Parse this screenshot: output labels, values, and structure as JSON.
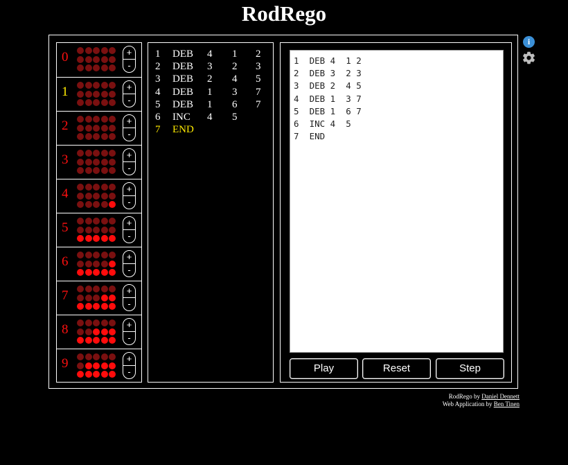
{
  "app": {
    "title": "RodRego"
  },
  "registers": [
    {
      "label": "0",
      "count": 0,
      "highlight": false
    },
    {
      "label": "1",
      "count": 0,
      "highlight": true
    },
    {
      "label": "2",
      "count": 0,
      "highlight": false
    },
    {
      "label": "3",
      "count": 0,
      "highlight": false
    },
    {
      "label": "4",
      "count": 1,
      "highlight": false
    },
    {
      "label": "5",
      "count": 5,
      "highlight": false
    },
    {
      "label": "6",
      "count": 6,
      "highlight": false
    },
    {
      "label": "7",
      "count": 7,
      "highlight": false
    },
    {
      "label": "8",
      "count": 8,
      "highlight": false
    },
    {
      "label": "9",
      "count": 9,
      "highlight": false
    }
  ],
  "register_controls": {
    "plus_label": "+",
    "minus_label": "-"
  },
  "program": [
    {
      "line": "1",
      "op": "DEB",
      "reg": "4",
      "a": "1",
      "b": "2",
      "current": false
    },
    {
      "line": "2",
      "op": "DEB",
      "reg": "3",
      "a": "2",
      "b": "3",
      "current": false
    },
    {
      "line": "3",
      "op": "DEB",
      "reg": "2",
      "a": "4",
      "b": "5",
      "current": false
    },
    {
      "line": "4",
      "op": "DEB",
      "reg": "1",
      "a": "3",
      "b": "7",
      "current": false
    },
    {
      "line": "5",
      "op": "DEB",
      "reg": "1",
      "a": "6",
      "b": "7",
      "current": false
    },
    {
      "line": "6",
      "op": "INC",
      "reg": "4",
      "a": "5",
      "b": "",
      "current": false
    },
    {
      "line": "7",
      "op": "END",
      "reg": "",
      "a": "",
      "b": "",
      "current": true
    }
  ],
  "editor": {
    "text": "1  DEB 4  1 2\n2  DEB 3  2 3\n3  DEB 2  4 5\n4  DEB 1  3 7\n5  DEB 1  6 7\n6  INC 4  5\n7  END"
  },
  "controls": {
    "play": "Play",
    "reset": "Reset",
    "step": "Step"
  },
  "icons": {
    "info": "info-icon",
    "settings": "gear-icon",
    "info_glyph": "i"
  },
  "colors": {
    "active_bead": "#ff0c0c",
    "inactive_bead": "#7a1010",
    "register_label": "#ff1010",
    "highlight": "#ffea00",
    "info": "#3b8fd6"
  },
  "credits": {
    "line1_prefix": "RodRego by ",
    "line1_link": "Daniel Dennett",
    "line2_prefix": "Web Application by ",
    "line2_link": "Ben Tinen"
  }
}
